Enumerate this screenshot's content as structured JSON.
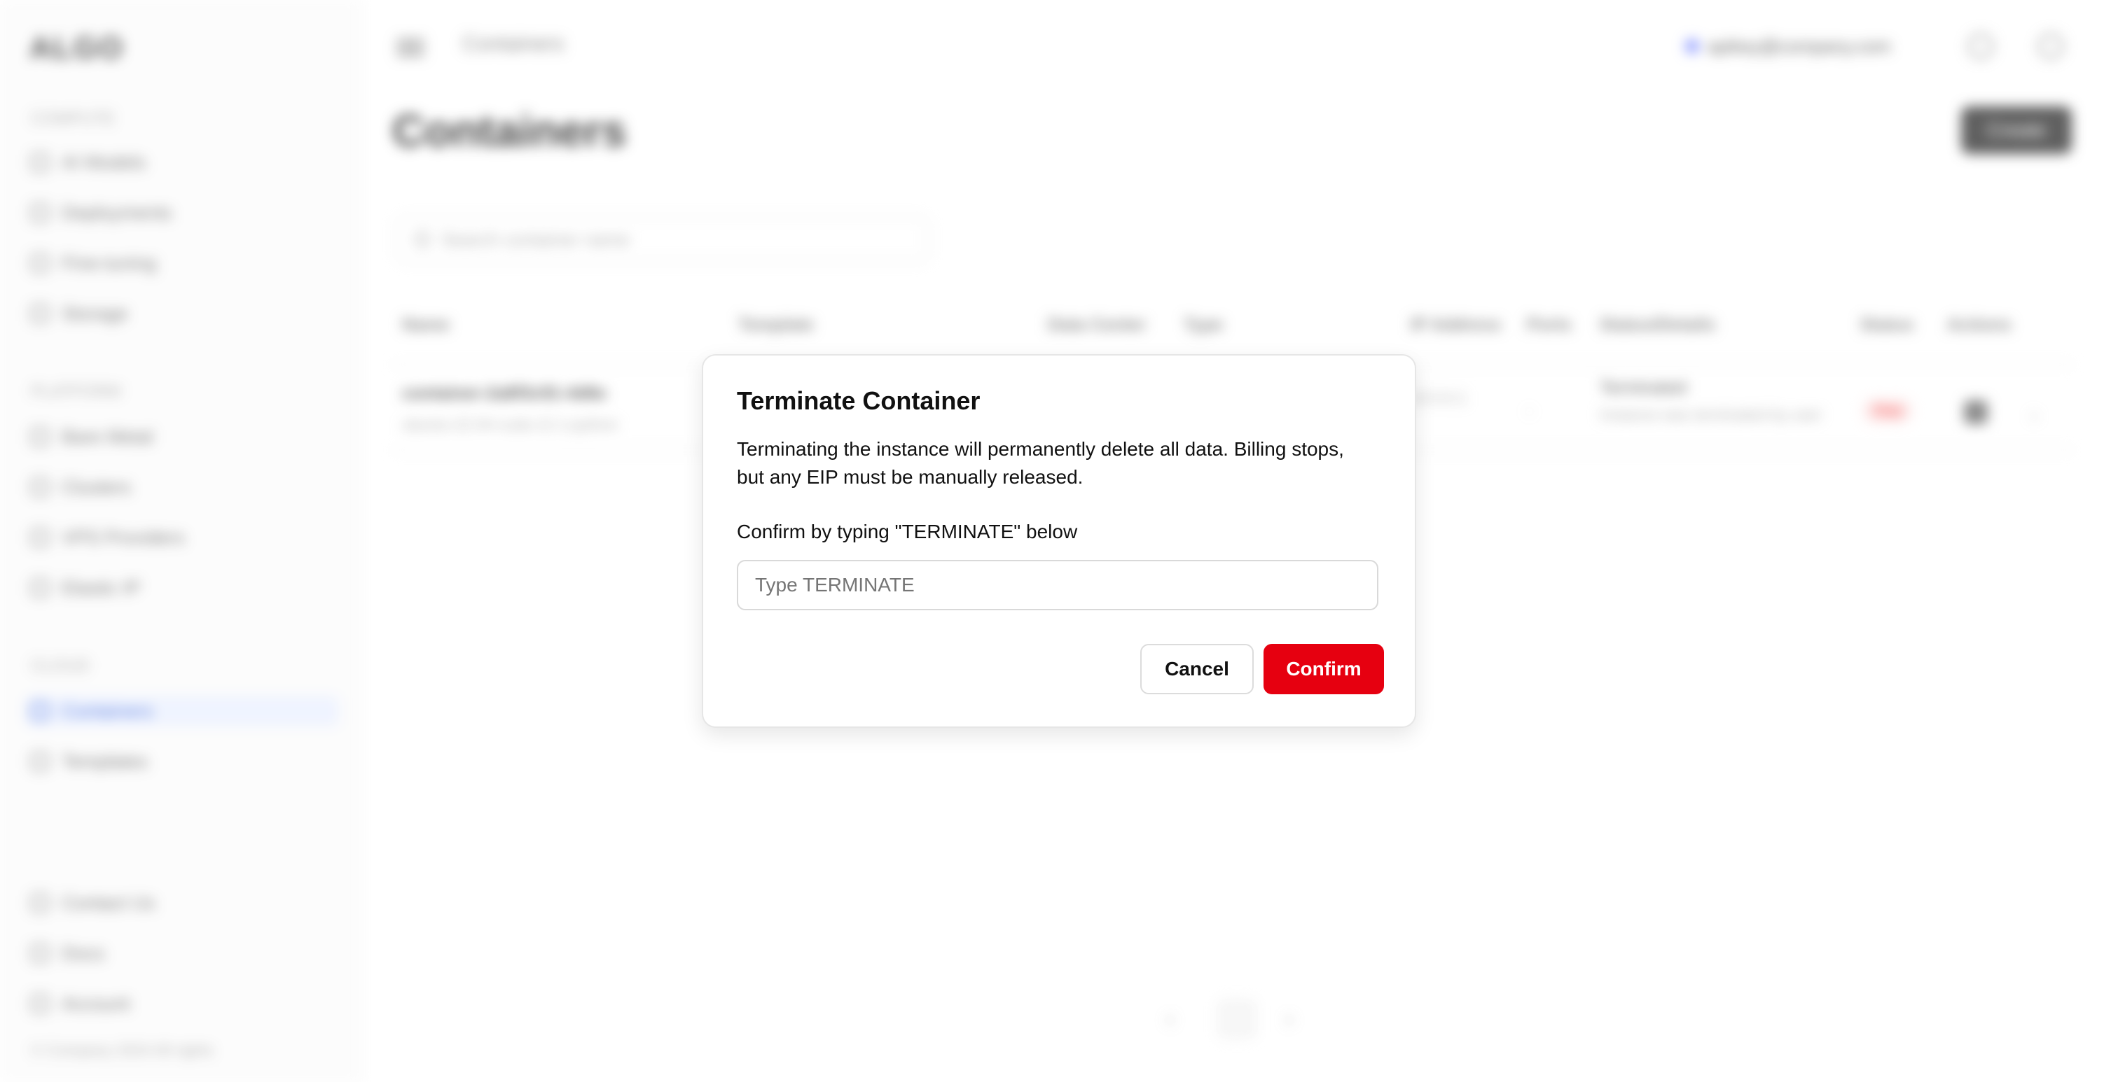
{
  "app": {
    "logo": "ALGO",
    "sidebar": {
      "sections": [
        {
          "label": "COMPUTE",
          "items": [
            "AI Models",
            "Deployments",
            "Fine-tuning",
            "Storage"
          ]
        },
        {
          "label": "PLATFORM",
          "items": [
            "Bare Metal",
            "Clusters",
            "VPS Providers",
            "Elastic IP"
          ]
        },
        {
          "label": "CLOUD",
          "items": [
            "Containers",
            "Templates"
          ]
        }
      ],
      "bottom_items": [
        "Contact Us",
        "Docs",
        "Account"
      ],
      "footer": "© Company 2024 All rights"
    },
    "topbar": {
      "breadcrumb": "Containers",
      "account": "apikey@company.com"
    },
    "page": {
      "title": "Containers",
      "create_button": "Create",
      "search_placeholder": "Search container name",
      "columns": [
        "Name",
        "Template",
        "Data Center",
        "Type",
        "IP Address",
        "Ports",
        "Status/Details",
        "Status",
        "Actions"
      ],
      "row": {
        "name": "container-2a8f3c91-4d6e",
        "name_sub": "ubuntu-22.04-cuda-12.1-python",
        "ip": "10.0.0.1",
        "ports": "-",
        "details": "Terminated",
        "details_sub": "Instance was terminated by user",
        "status": "Stop"
      },
      "pagination": {
        "prev": "‹",
        "current": "1",
        "next": "›"
      }
    }
  },
  "modal": {
    "title": "Terminate Container",
    "description": "Terminating the instance will permanently delete all data. Billing stops, but any EIP must be manually released.",
    "confirm_label": "Confirm by typing \"TERMINATE\" below",
    "input_placeholder": "Type TERMINATE",
    "input_value": "",
    "cancel_label": "Cancel",
    "confirm_button_label": "Confirm",
    "colors": {
      "danger": "#e60010",
      "border": "#d9d9d9"
    }
  }
}
